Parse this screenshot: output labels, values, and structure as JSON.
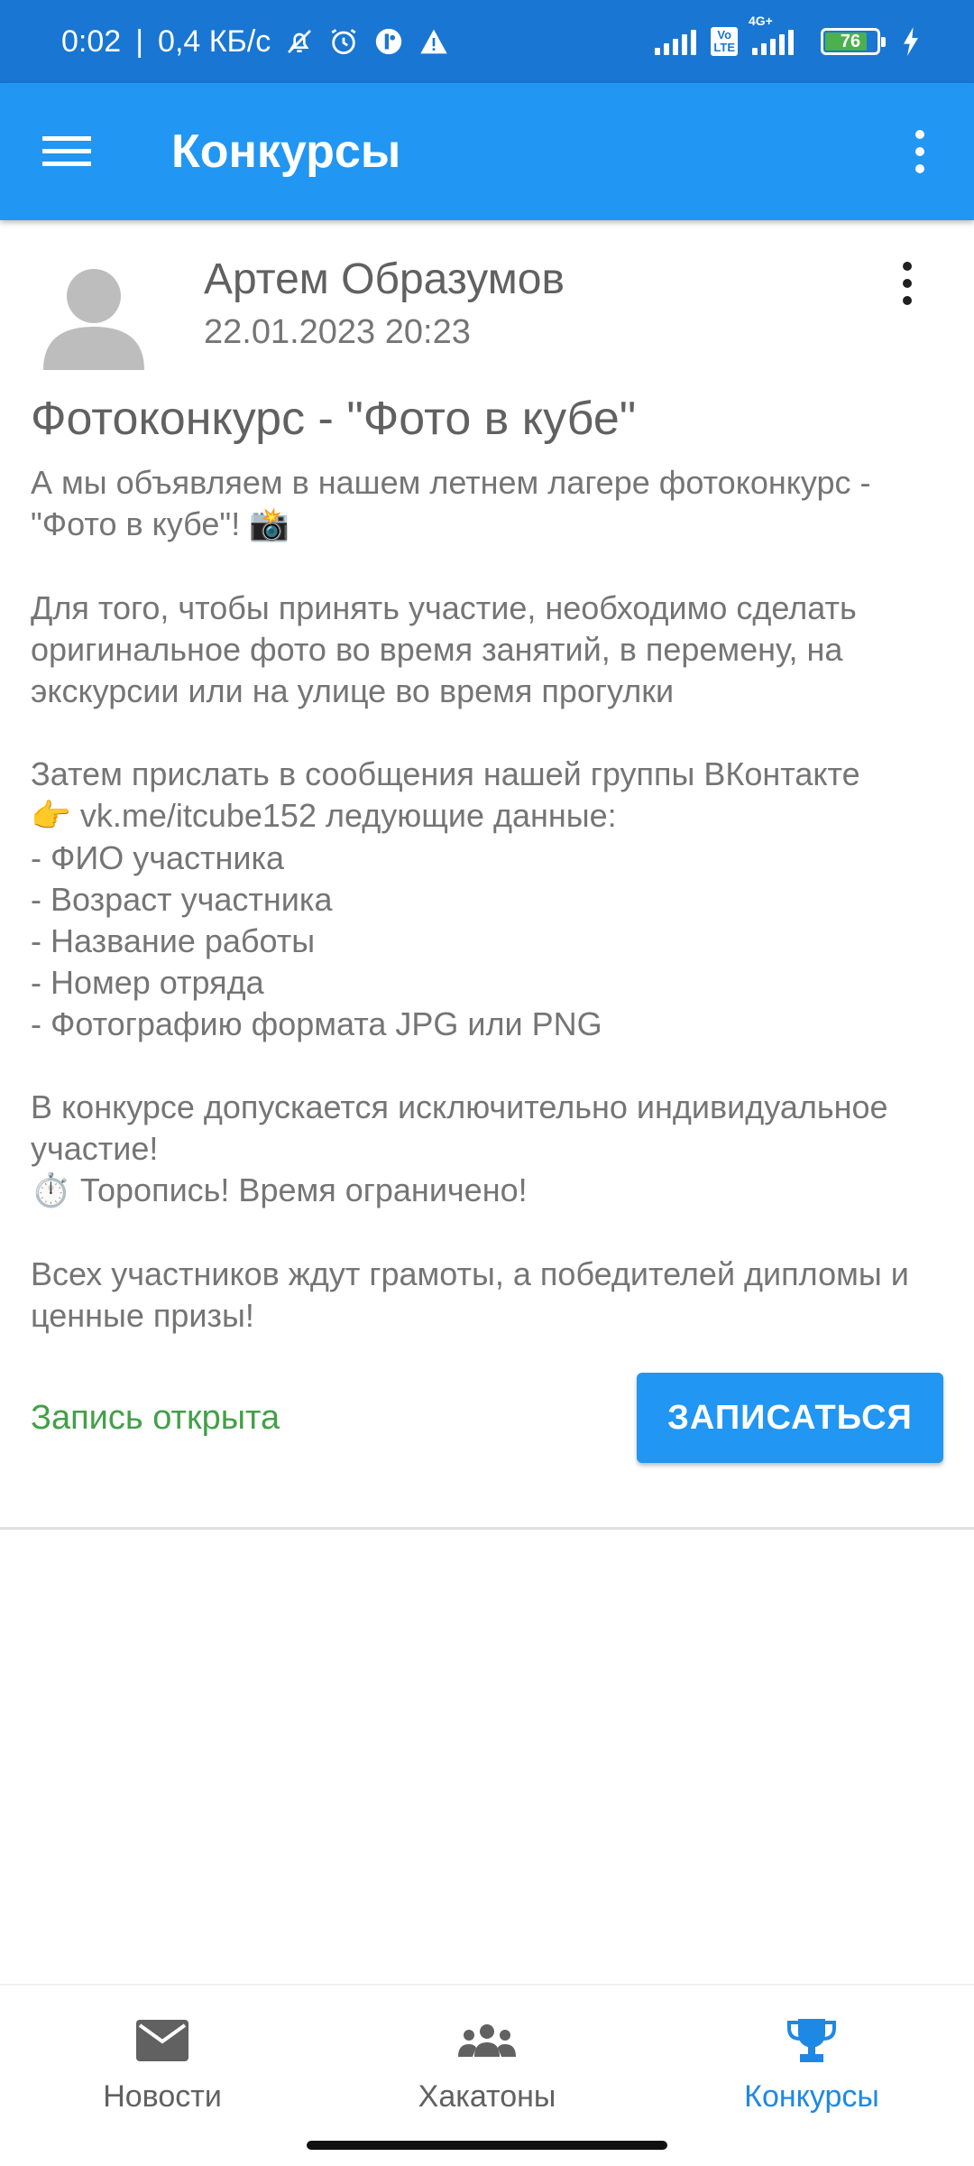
{
  "status_bar": {
    "time": "0:02",
    "separator": "|",
    "net_speed": "0,4 КБ/с",
    "network_label": "4G+",
    "volte_line1": "Vo",
    "volte_line2": "LTE",
    "battery_level": "76",
    "icons": [
      "bell-off-icon",
      "alarm-icon",
      "vpn-icon",
      "warning-icon",
      "signal-icon",
      "volte-icon",
      "signal-icon",
      "battery-icon",
      "charging-icon"
    ]
  },
  "app_bar": {
    "title": "Конкурсы",
    "icons": [
      "menu-icon",
      "more-vert-icon"
    ]
  },
  "post": {
    "author": "Артем Образумов",
    "date": "22.01.2023 20:23",
    "title": "Фотоконкурс - \"Фото в кубе\"",
    "paragraph1": "А мы объявляем в нашем летнем лагере фотоконкурс - \"Фото в кубе\"! ",
    "camera_emoji": "📸",
    "paragraph2": "Для того, чтобы принять участие, необходимо сделать оригинальное фото во время занятий, в перемену, на экскурсии или на улице во время прогулки",
    "paragraph3_line1": "Затем прислать в сообщения нашей группы ВКонтакте",
    "pointing_emoji": "👉",
    "paragraph3_line2": " vk.me/itcube152 ледующие данные:",
    "list": [
      "- ФИО участника",
      "- Возраст участника",
      "- Название работы",
      "- Номер отряда",
      "- Фотографию формата JPG или PNG"
    ],
    "paragraph4": "В конкурсе допускается исключительно индивидуальное участие!",
    "timer_emoji": "⏱️",
    "paragraph4_line2": " Торопись! Время ограничено!",
    "paragraph5": "Всех участников ждут грамоты, а победителей дипломы и ценные призы!",
    "signup_status": "Запись открыта",
    "signup_button": "ЗАПИСАТЬСЯ"
  },
  "bottom_nav": {
    "items": [
      {
        "label": "Новости",
        "icon": "mail-icon",
        "active": false
      },
      {
        "label": "Хакатоны",
        "icon": "groups-icon",
        "active": false
      },
      {
        "label": "Конкурсы",
        "icon": "trophy-icon",
        "active": true
      }
    ]
  },
  "colors": {
    "status_bar": "#1976d2",
    "app_bar": "#2196f3",
    "accent": "#2196f3",
    "status_open": "#43a047",
    "nav_active": "#1e88e5"
  }
}
